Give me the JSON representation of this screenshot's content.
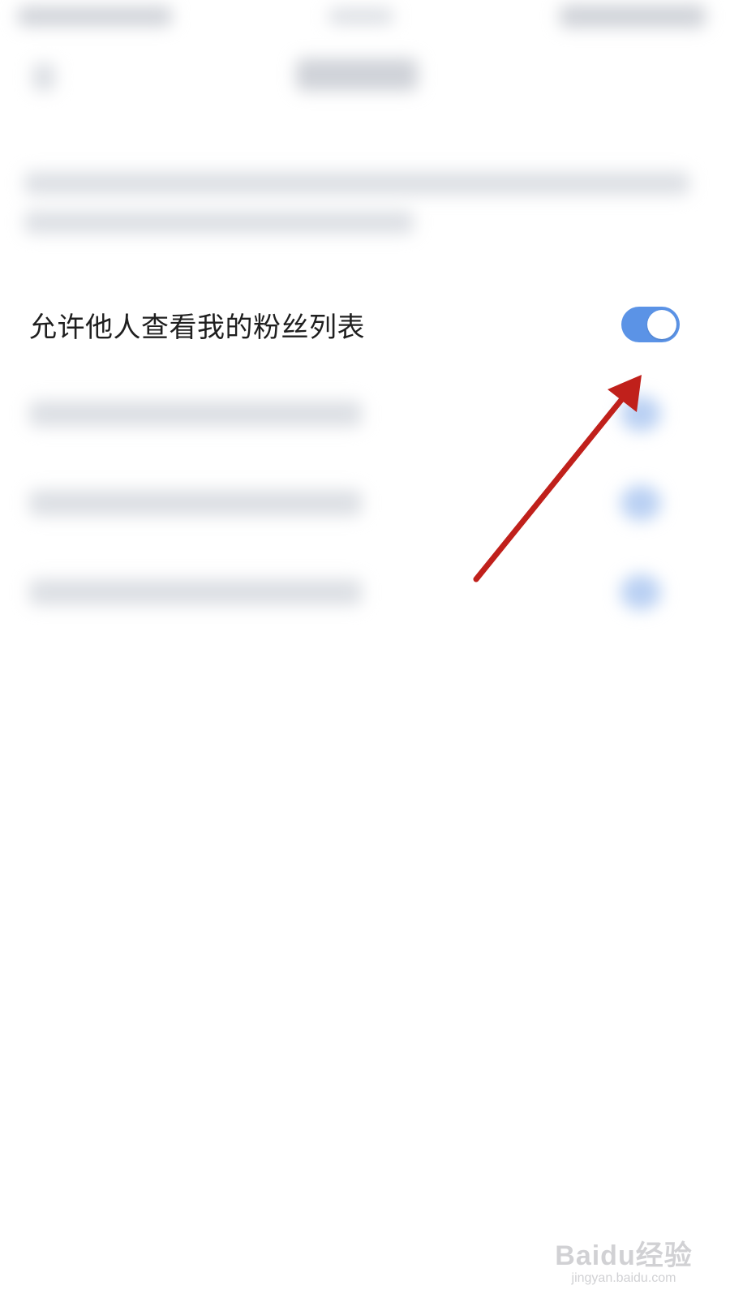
{
  "setting": {
    "label": "允许他人查看我的粉丝列表",
    "toggle_on": true
  },
  "colors": {
    "toggle_accent": "#5b93e6",
    "arrow": "#c0201b"
  },
  "watermark": {
    "logo": "Baidu经验",
    "url": "jingyan.baidu.com"
  }
}
